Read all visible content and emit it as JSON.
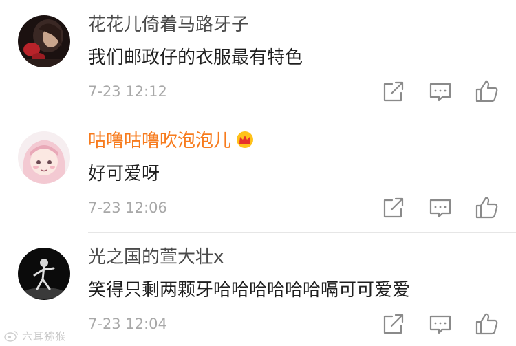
{
  "accent_colors": {
    "username_default": "#4a4a4a",
    "username_vip": "#f77b1d",
    "timestamp": "#a8a8a8",
    "icon": "#8a8a8a"
  },
  "comments": [
    {
      "username": "花花儿倚着马路牙子",
      "vip": false,
      "text": "我们邮政仔的衣服最有特色",
      "time": "7-23 12:12",
      "avatar_icon": "avatar-dark-photo"
    },
    {
      "username": "咕噜咕噜吹泡泡儿",
      "vip": true,
      "badge_icon": "crown-icon",
      "text": "好可爱呀",
      "time": "7-23 12:06",
      "avatar_icon": "avatar-anime-girl"
    },
    {
      "username": "光之国的萱大壮x",
      "vip": false,
      "text": "笑得只剩两颗牙哈哈哈哈哈哈嗝可可爱爱",
      "time": "7-23 12:04",
      "avatar_icon": "avatar-dark-figure"
    }
  ],
  "action_icons": [
    "share-icon",
    "comment-icon",
    "like-icon"
  ],
  "watermark": {
    "text": "六耳猕猴",
    "icon": "weibo-logo-icon"
  }
}
